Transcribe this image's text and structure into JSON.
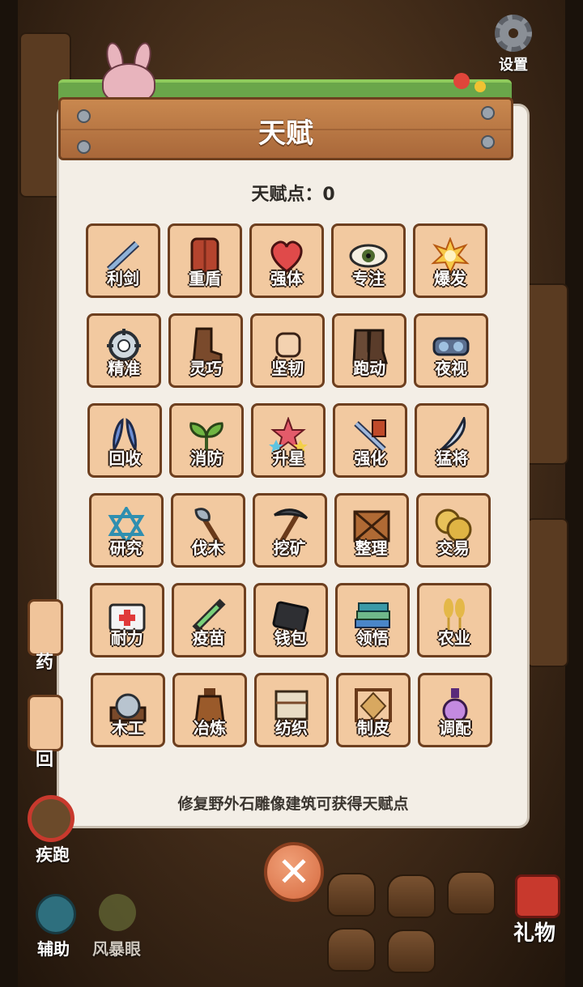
{
  "header": {
    "settings_label": "设置"
  },
  "dialog": {
    "title": "天赋",
    "points_text": "天赋点：0",
    "footer_note": "修复野外石雕像建筑可获得天赋点"
  },
  "talents": [
    {
      "label": "利剑",
      "icon": "sword-icon"
    },
    {
      "label": "重盾",
      "icon": "shield-icon"
    },
    {
      "label": "强体",
      "icon": "heart-icon"
    },
    {
      "label": "专注",
      "icon": "eye-icon"
    },
    {
      "label": "爆发",
      "icon": "explosion-icon"
    },
    {
      "label": "精准",
      "icon": "crosshair-icon"
    },
    {
      "label": "灵巧",
      "icon": "leather-boot-icon"
    },
    {
      "label": "坚韧",
      "icon": "fist-icon"
    },
    {
      "label": "跑动",
      "icon": "running-boots-icon"
    },
    {
      "label": "夜视",
      "icon": "goggles-icon"
    },
    {
      "label": "回收",
      "icon": "feather-icon"
    },
    {
      "label": "消防",
      "icon": "sprout-icon"
    },
    {
      "label": "升星",
      "icon": "stars-icon"
    },
    {
      "label": "强化",
      "icon": "sword-upgrade-icon"
    },
    {
      "label": "猛将",
      "icon": "curved-blade-icon"
    },
    {
      "label": "研究",
      "icon": "hexagram-icon"
    },
    {
      "label": "伐木",
      "icon": "axe-icon"
    },
    {
      "label": "挖矿",
      "icon": "pickaxe-icon"
    },
    {
      "label": "整理",
      "icon": "crate-icon"
    },
    {
      "label": "交易",
      "icon": "coins-icon"
    },
    {
      "label": "耐力",
      "icon": "medkit-icon"
    },
    {
      "label": "疫苗",
      "icon": "syringe-icon"
    },
    {
      "label": "钱包",
      "icon": "wallet-icon"
    },
    {
      "label": "领悟",
      "icon": "books-icon"
    },
    {
      "label": "农业",
      "icon": "wheat-icon"
    },
    {
      "label": "木工",
      "icon": "saw-icon"
    },
    {
      "label": "冶炼",
      "icon": "furnace-icon"
    },
    {
      "label": "纺织",
      "icon": "loom-icon"
    },
    {
      "label": "制皮",
      "icon": "hide-rack-icon"
    },
    {
      "label": "调配",
      "icon": "potion-icon"
    }
  ],
  "side": {
    "partial_label_1": "药",
    "partial_label_2": "回",
    "sprint_label": "疾跑",
    "assist_label": "辅助",
    "storm_eye_label": "风暴眼",
    "gift_label": "礼物"
  }
}
